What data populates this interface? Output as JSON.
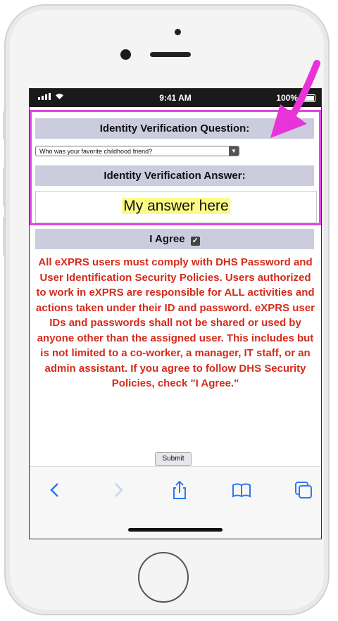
{
  "status_bar": {
    "time": "9:41 AM",
    "battery": "100%"
  },
  "question_header": "Identity Verification Question:",
  "question_select": {
    "selected": "Who was your favorite childhood friend?"
  },
  "answer_header": "Identity Verification Answer:",
  "answer_value": "My answer here",
  "agree_label": "I Agree",
  "policy_text": "All eXPRS users must comply with DHS Password and User Identification Security Policies. Users authorized to work in eXPRS are responsible for ALL activities and actions taken under their ID and password. eXPRS user IDs and passwords shall not be shared or used by anyone other than the assigned user. This includes but is not limited to a co-worker, a manager, IT staff, or an admin assistant. If you agree to follow DHS Security Policies, check \"I Agree.\"",
  "submit_label": "Submit",
  "toolbar": {
    "icons": [
      "back-icon",
      "forward-icon",
      "share-icon",
      "bookmarks-icon",
      "tabs-icon"
    ]
  },
  "colors": {
    "header_bg": "#ccccdf",
    "policy_text": "#d42b1c",
    "highlight_border": "#e048e0",
    "answer_highlight": "#fbfb85",
    "toolbar_icon": "#2b78f0"
  }
}
